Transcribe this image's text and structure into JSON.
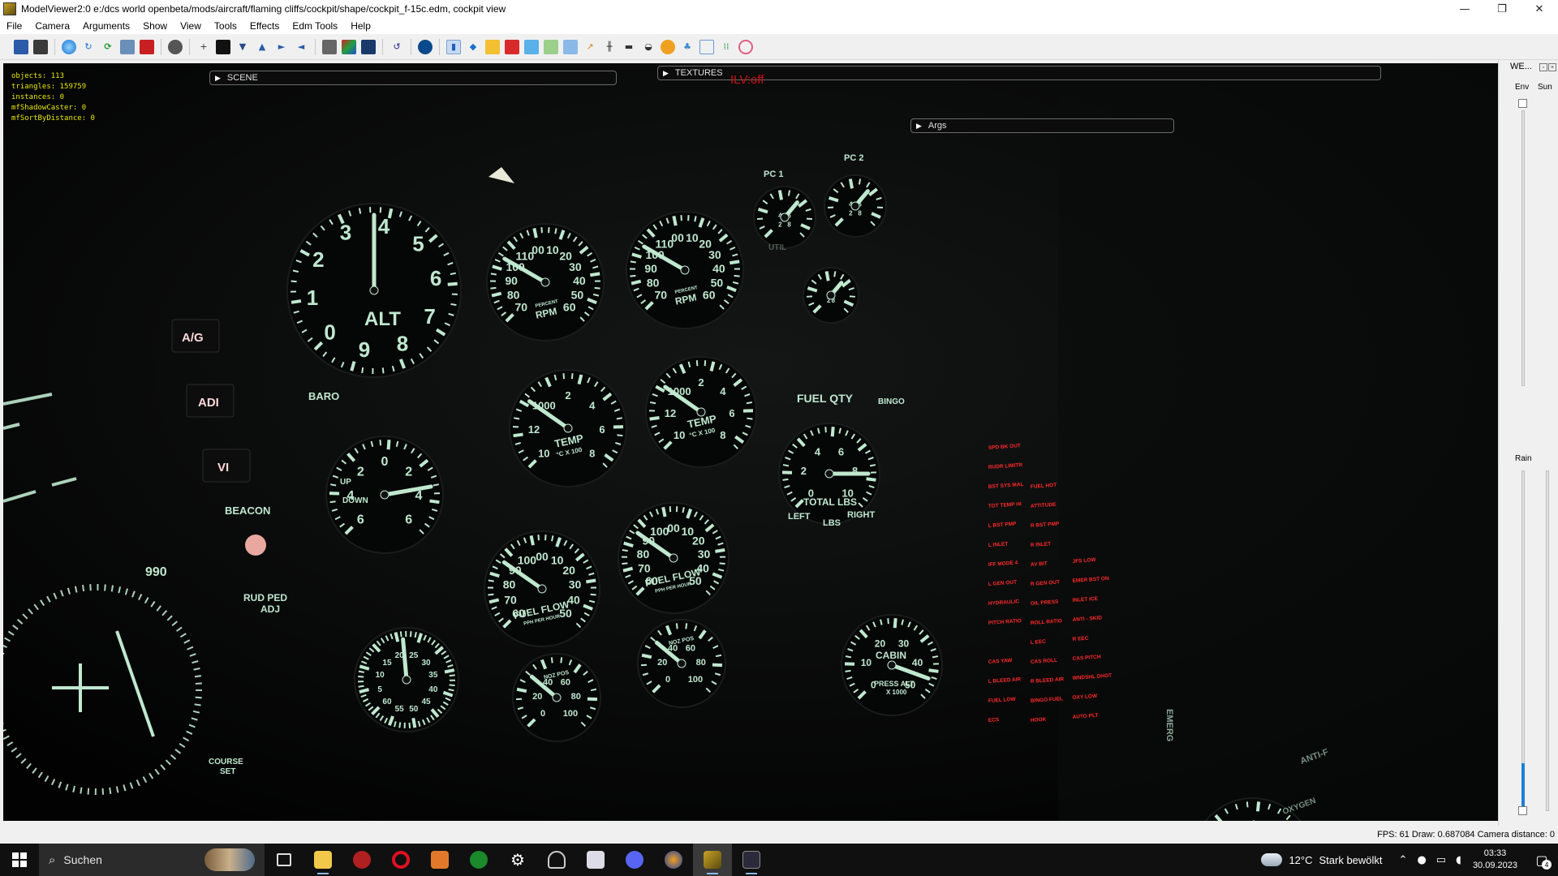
{
  "window": {
    "title": "ModelViewer2:0 e:/dcs world openbeta/mods/aircraft/flaming cliffs/cockpit/shape/cockpit_f-15c.edm, cockpit view",
    "minimize": "—",
    "maximize": "❐",
    "close": "✕"
  },
  "menu": [
    "File",
    "Camera",
    "Arguments",
    "Show",
    "View",
    "Tools",
    "Effects",
    "Edm Tools",
    "Help"
  ],
  "stats": {
    "objects": "objects: 113",
    "triangles": "triangles: 159759",
    "instances": "instances: 0",
    "shadow_caster": "mfShadowCaster: 0",
    "sort_by_distance": "mfSortByDistance: 0"
  },
  "panels": {
    "scene": "SCENE",
    "textures": "TEXTURES",
    "args": "Args",
    "ilv": "ILV:off"
  },
  "cockpit": {
    "alt": "ALT",
    "baro": "BARO",
    "ag": "A/G",
    "adi": "ADI",
    "vi": "VI",
    "beacon": "BEACON",
    "rud_ped": "RUD PED",
    "adj": "ADJ",
    "course": "COURSE",
    "set": "SET",
    "rpm": "RPM",
    "percent": "PERCENT",
    "temp": "TEMP",
    "temp_units": "°C X 100",
    "fuel_flow": "FUEL FLOW",
    "pph": "PPH PER HOUR",
    "noz_pos": "NOZ POS",
    "pc1": "PC 1",
    "pc2": "PC 2",
    "util": "UTIL",
    "fuel_qty": "FUEL QTY",
    "bingo": "BINGO",
    "total_lbs": "TOTAL LBS",
    "left": "LEFT",
    "right": "RIGHT",
    "lbs": "LBS",
    "cabin": "CABIN",
    "press_alt": "PRESS ALT",
    "x1000": "X 1000",
    "emerg": "EMERG",
    "anti_f": "ANTI-F",
    "oxygen": "OXYGEN",
    "up": "UP",
    "down": "DOWN",
    "hdg": "990"
  },
  "warning_panel": [
    [
      "SPD BK OUT",
      "",
      ""
    ],
    [
      "RUDR LIMITR",
      "",
      ""
    ],
    [
      "BST SYS MAL",
      "FUEL HOT",
      ""
    ],
    [
      "TOT TEMP HI",
      "ATTITUDE",
      ""
    ],
    [
      "L BST PMP",
      "R BST PMP",
      ""
    ],
    [
      "L INLET",
      "R INLET",
      ""
    ],
    [
      "IFF MODE 4",
      "AV BIT",
      "JFS LOW"
    ],
    [
      "L GEN OUT",
      "R GEN OUT",
      "EMER BST ON"
    ],
    [
      "HYDRAULIC",
      "OIL PRESS",
      "INLET ICE"
    ],
    [
      "PITCH RATIO",
      "ROLL RATIO",
      "ANTI - SKID"
    ],
    [
      "",
      "L EEC",
      "R EEC"
    ],
    [
      "CAS YAW",
      "CAS ROLL",
      "CAS PITCH"
    ],
    [
      "L BLEED AIR",
      "R BLEED AIR",
      "WNDSHL DHOT"
    ],
    [
      "FUEL LOW",
      "BINGO FUEL",
      "OXY LOW"
    ],
    [
      "ECS",
      "HOOK",
      "AUTO PLT"
    ]
  ],
  "sidepanel": {
    "title": "WE...",
    "env": "Env",
    "sun": "Sun",
    "rain": "Rain",
    "rain_level": 0.14
  },
  "statusbar": {
    "text": "FPS: 61  Draw: 0.687084  Camera distance: 0"
  },
  "taskbar": {
    "search": "Suchen",
    "temperature": "12°C",
    "weather": "Stark bewölkt",
    "time": "03:33",
    "date": "30.09.2023",
    "notifications": "4"
  },
  "colors": {
    "gauge": "#bfe8cf",
    "warning": "#ff2a2a",
    "stats": "#e8e800",
    "ilv": "#cc1010"
  }
}
